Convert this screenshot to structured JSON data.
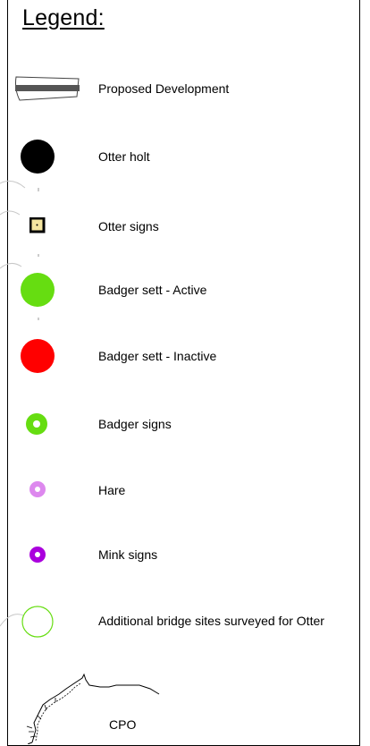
{
  "legend": {
    "title": "Legend:",
    "items": [
      {
        "label": "Proposed Development",
        "icon": "proposed-development-icon"
      },
      {
        "label": "Otter holt",
        "icon": "otter-holt-icon",
        "color": "#000000"
      },
      {
        "label": "Otter signs",
        "icon": "otter-signs-icon",
        "color": "#f5e6a0"
      },
      {
        "label": "Badger sett - Active",
        "icon": "badger-sett-active-icon",
        "color": "#66dd11"
      },
      {
        "label": "Badger sett - Inactive",
        "icon": "badger-sett-inactive-icon",
        "color": "#ff0000"
      },
      {
        "label": "Badger signs",
        "icon": "badger-signs-icon",
        "color": "#66dd11"
      },
      {
        "label": "Hare",
        "icon": "hare-icon",
        "color": "#dd88ee"
      },
      {
        "label": "Mink signs",
        "icon": "mink-signs-icon",
        "color": "#aa00dd"
      },
      {
        "label": "Additional bridge sites surveyed for Otter",
        "icon": "bridge-site-icon",
        "color": "#66dd11"
      },
      {
        "label": "CPO",
        "icon": "cpo-boundary-icon"
      }
    ]
  }
}
